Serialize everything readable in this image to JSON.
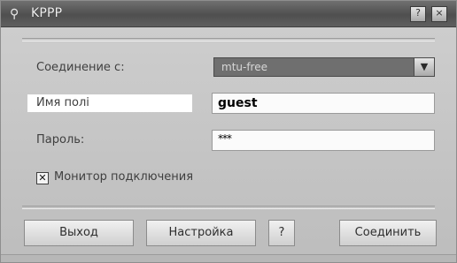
{
  "window": {
    "title_icon": "kppp-icon",
    "title": "KPPP",
    "help_button": "?",
    "close_button": "×"
  },
  "form": {
    "connection_label": "Соединение с:",
    "connection_value": "mtu-free",
    "username_label": "Имя полі",
    "username_value": "guest",
    "password_label": "Пароль:",
    "password_value": "***",
    "monitor_label": "Монитор подключения",
    "monitor_checked": true
  },
  "buttons": {
    "exit": "Выход",
    "settings": "Настройка",
    "help": "?",
    "connect": "Соединить"
  },
  "icons": {
    "dropdown": "chevron-down-icon",
    "checkbox": "checkbox-icon"
  }
}
